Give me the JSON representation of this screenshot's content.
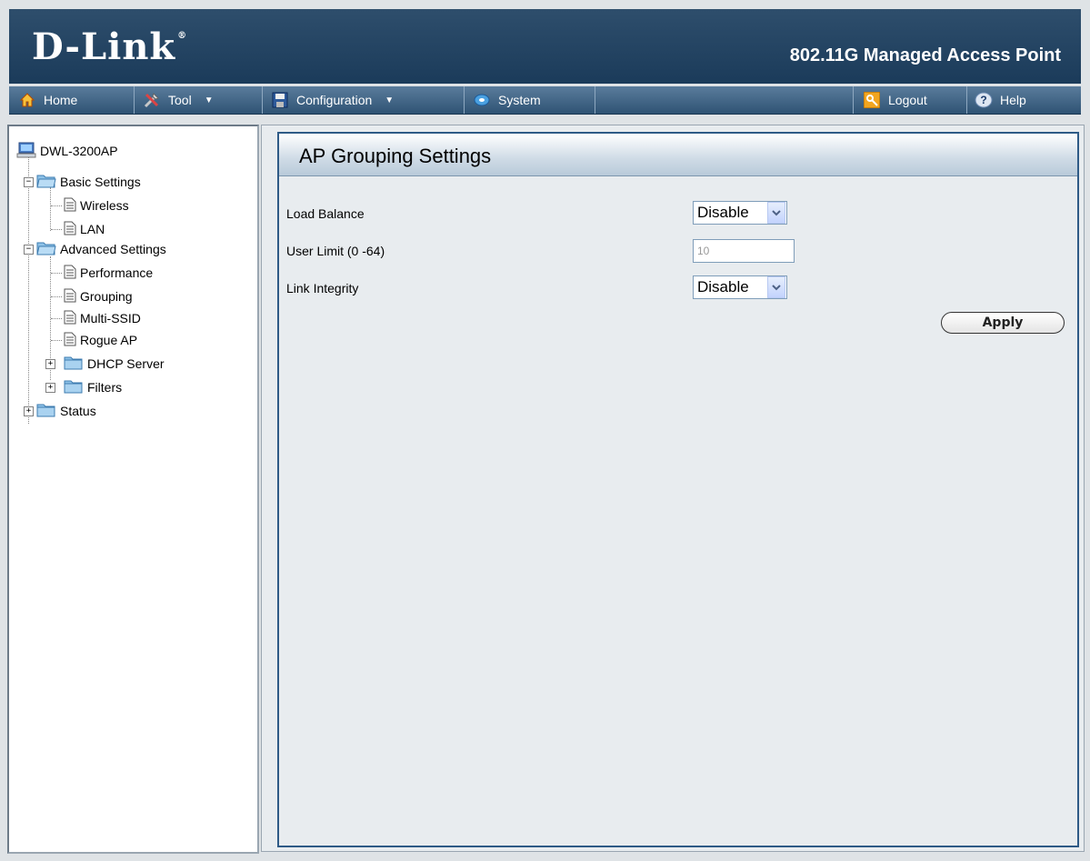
{
  "header": {
    "brand": "D-Link",
    "brand_mark": "®",
    "product_title": "802.11G Managed Access Point"
  },
  "toolbar": {
    "home": "Home",
    "tool": "Tool",
    "configuration": "Configuration",
    "system": "System",
    "logout": "Logout",
    "help": "Help"
  },
  "tree": {
    "root": "DWL-3200AP",
    "basic_settings": "Basic Settings",
    "wireless": "Wireless",
    "lan": "LAN",
    "advanced_settings": "Advanced Settings",
    "performance": "Performance",
    "grouping": "Grouping",
    "multi_ssid": "Multi-SSID",
    "rogue_ap": "Rogue AP",
    "dhcp_server": "DHCP Server",
    "filters": "Filters",
    "status": "Status"
  },
  "main": {
    "title": "AP Grouping Settings",
    "load_balance": {
      "label": "Load Balance",
      "value": "Disable"
    },
    "user_limit": {
      "label": "User Limit (0 -64)",
      "value": "10"
    },
    "link_integrity": {
      "label": "Link Integrity",
      "value": "Disable"
    },
    "apply_label": "Apply"
  },
  "colors": {
    "header_band": "#1f3f5e",
    "toolbar": "#3e6283",
    "section_border": "#2e5a86"
  }
}
